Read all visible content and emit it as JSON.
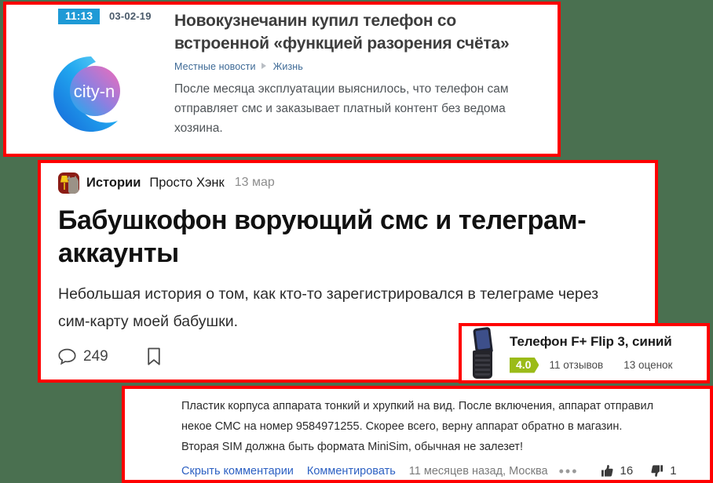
{
  "background_color": "#4a7050",
  "highlight_border_color": "#ff0000",
  "news_panel": {
    "time_badge": "11:13",
    "date": "03-02-19",
    "logo_text": "city-n",
    "title": "Новокузнечанин купил телефон со встроенной «функцией разорения счёта»",
    "breadcrumb": {
      "section": "Местные новости",
      "subsection": "Жизнь"
    },
    "lead": "После месяца эксплуатации выяснилось, что телефон сам отправляет смс и заказывает платный контент без ведома хозяина."
  },
  "story_panel": {
    "source": "Истории",
    "author": "Просто Хэнк",
    "date": "13 мар",
    "title": "Бабушкофон ворующий смс и телеграм-аккаунты",
    "lead": "Небольшая история о том, как кто-то зарегистрировался в телеграме через сим-карту моей бабушки.",
    "comments_count": "249"
  },
  "product_panel": {
    "title": "Телефон F+ Flip 3, синий",
    "rating": "4.0",
    "rating_color": "#9bbb18",
    "reviews": "11 отзывов",
    "ratings": "13 оценок"
  },
  "comment_panel": {
    "lines": [
      "Пластик корпуса аппарата тонкий и хрупкий на вид. После включения, аппарат отправил",
      "некое СМС на номер 9584971255. Скорее всего, верну аппарат обратно в магазин.",
      "Вторая SIM должна быть формата MiniSim, обычная не залезет!"
    ],
    "hide_comments_link": "Скрыть комментарии",
    "comment_link": "Комментировать",
    "when": "11 месяцев назад, Москва",
    "more_dots": "•••",
    "likes": "16",
    "dislikes": "1"
  }
}
